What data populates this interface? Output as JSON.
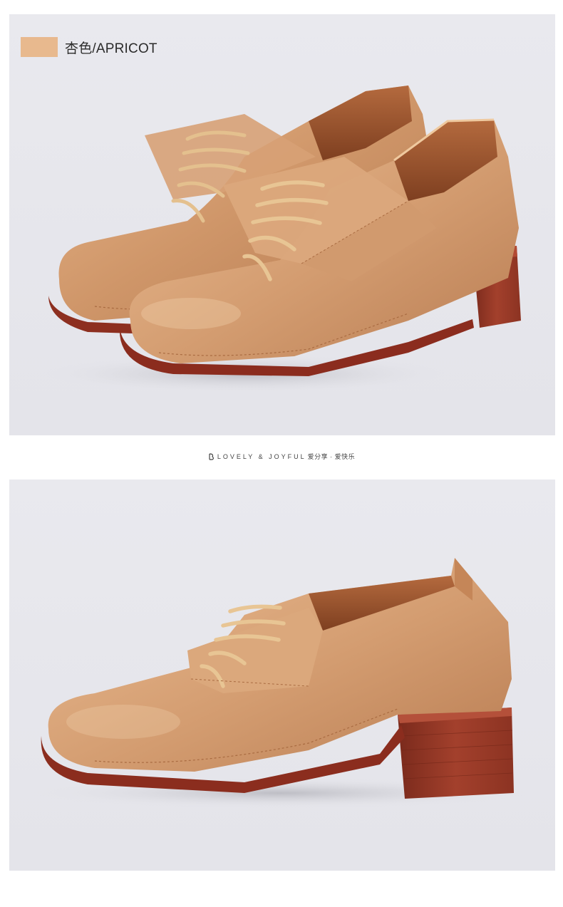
{
  "color_option": {
    "swatch_color": "#e8b98e",
    "label": "杏色/APRICOT"
  },
  "tagline": {
    "english": "LOVELY & JOYFUL",
    "chinese": "爱分享 · 爱快乐"
  },
  "images": {
    "top": "shoe-pair-angled-view",
    "bottom": "shoe-side-view"
  }
}
